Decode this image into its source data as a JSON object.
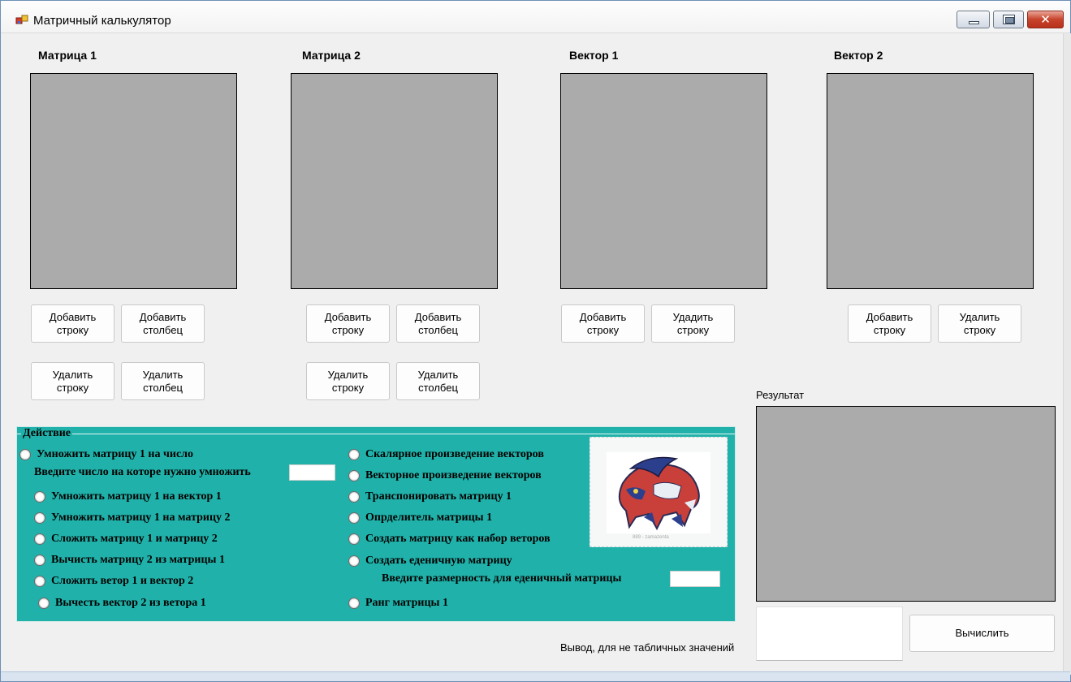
{
  "window": {
    "title": "Матричный калькулятор",
    "controls": [
      "minimize",
      "maximize",
      "close"
    ],
    "close_glyph": "✕"
  },
  "panels": {
    "matrix1_label": "Матрица 1",
    "matrix2_label": "Матрица 2",
    "vector1_label": "Вектор 1",
    "vector2_label": "Вектор 2"
  },
  "buttons": {
    "m1_add_row": "Добавить строку",
    "m1_add_col": "Добавить столбец",
    "m1_del_row": "Удалить строку",
    "m1_del_col": "Удалить столбец",
    "m2_add_row": "Добавить строку",
    "m2_add_col": "Добавить столбец",
    "m2_del_row": "Удалить строку",
    "m2_del_col": "Удалить столбец",
    "v1_add_row": "Добавить строку",
    "v1_del_row": "Удадить строку",
    "v2_add_row": "Добавить строку",
    "v2_del_row": "Удалить строку",
    "calculate": "Вычислить"
  },
  "result": {
    "label": "Результат",
    "output_label": "Вывод, для не табличных значений",
    "output_value": ""
  },
  "action_group": {
    "title": "Действие",
    "multiply_by_number": "Умножить матрицу 1 на число",
    "number_hint": "Введите число на которе нужно умножить",
    "number_value": "",
    "left_options": [
      "Умножить матрицу 1 на вектор 1",
      "Умножить матрицу 1 на матрицу 2",
      "Сложить матрицу 1 и матрицу 2",
      "Вычисть матрицу 2 из матрицы 1",
      "Сложить ветор 1 и вектор 2",
      "Вычесть вектор 2 из ветора 1"
    ],
    "right_options": [
      "Скалярное произведение векторов",
      "Векторное произведение векторов",
      "Транспонировать матрицу 1",
      "Опрделитель матрицы 1",
      "Создать матрицу как набор веторов",
      "Создать еденичную матрицу"
    ],
    "identity_hint": "Введите размерность для еденичный матрицы",
    "identity_value": "",
    "rank_option": "Ранг матрицы 1",
    "picture_caption": "889 - zamazenta"
  },
  "colors": {
    "group_bg": "#20b2aa",
    "grid_bg": "#ababab",
    "window_bg": "#f0f0f0"
  }
}
